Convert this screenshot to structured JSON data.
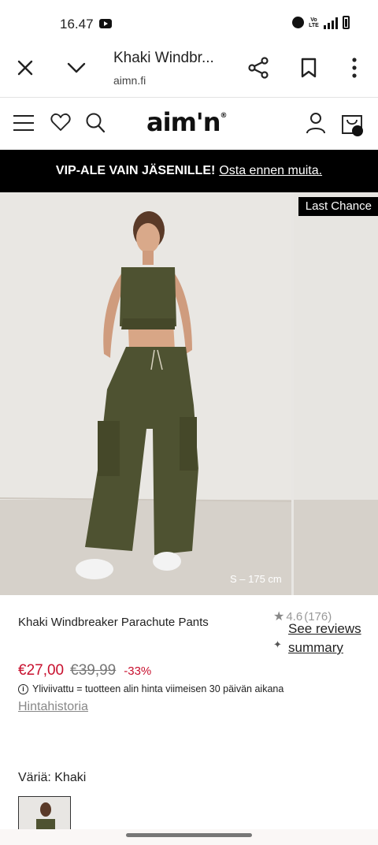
{
  "status_bar": {
    "time": "16.47",
    "icons": [
      "youtube-icon",
      "alarm-icon",
      "volte-icon",
      "4g-signal-icon",
      "battery-icon"
    ],
    "volte_text": "Vo LTE"
  },
  "browser": {
    "title": "Khaki Windbr...",
    "url": "aimn.fi",
    "icons": [
      "close-icon",
      "chevron-down-icon",
      "share-icon",
      "bookmark-icon",
      "more-vert-icon"
    ]
  },
  "site_header": {
    "logo": "aim'n",
    "icons": [
      "menu-icon",
      "heart-icon",
      "search-icon",
      "account-icon",
      "cart-icon"
    ]
  },
  "promo": {
    "strong_text": "VIP-ALE VAIN JÄSENILLE!",
    "link_text": "Osta ennen muita."
  },
  "gallery": {
    "badge": "Last Chance",
    "size_caption": "S – 175 cm"
  },
  "product": {
    "name": "Khaki Windbreaker Parachute Pants",
    "rating": "4.6",
    "review_count": "(176)",
    "reviews_link": "See reviews summary",
    "price_now": "€27,00",
    "price_old": "€39,99",
    "discount": "-33%",
    "info_text": "Yliviivattu = tuotteen alin hinta viimeisen 30 päivän aikana",
    "history_link": "Hintahistoria",
    "color_label": "Väriä: Khaki"
  },
  "colors": {
    "accent_red": "#c8102e",
    "promo_bg": "#000000",
    "khaki": "#4e5231"
  }
}
